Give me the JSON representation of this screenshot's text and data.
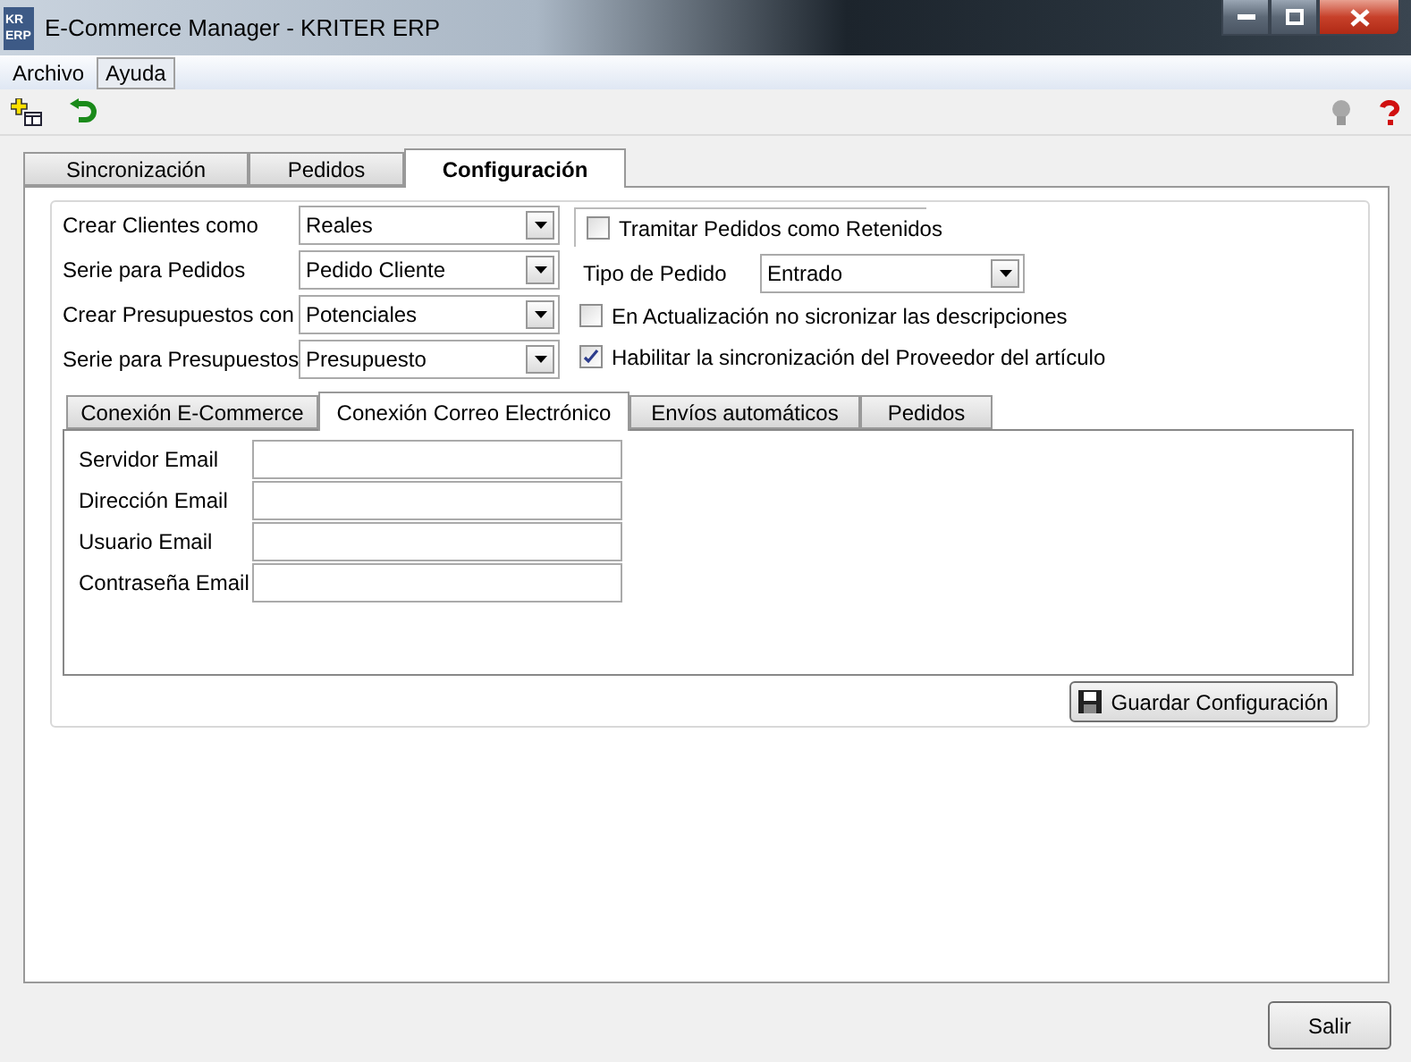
{
  "window": {
    "title": "E-Commerce Manager - KRITER ERP",
    "app_badge": [
      "KR",
      "ERP"
    ]
  },
  "menu": [
    {
      "label": "Archivo",
      "highlighted": false
    },
    {
      "label": "Ayuda",
      "highlighted": true
    }
  ],
  "tabs": [
    {
      "label": "Sincronización",
      "selected": false
    },
    {
      "label": "Pedidos",
      "selected": false
    },
    {
      "label": "Configuración",
      "selected": true
    }
  ],
  "settings": {
    "combos": [
      {
        "label": "Crear Clientes como",
        "value": "Reales"
      },
      {
        "label": "Serie para Pedidos",
        "value": "Pedido Cliente"
      },
      {
        "label": "Crear Presupuestos con",
        "value": "Potenciales"
      },
      {
        "label": "Serie para Presupuestos",
        "value": "Presupuesto"
      }
    ],
    "retained": {
      "label": "Tramitar Pedidos como Retenidos",
      "checked": false
    },
    "order_type": {
      "label": "Tipo de Pedido",
      "value": "Entrado"
    },
    "checks": [
      {
        "label": "En Actualización no sicronizar las descripciones",
        "checked": false
      },
      {
        "label": "Habilitar la sincronización del Proveedor del artículo",
        "checked": true
      }
    ]
  },
  "sub_tabs": [
    {
      "label": "Conexión E-Commerce",
      "selected": false
    },
    {
      "label": "Conexión Correo Electrónico",
      "selected": true
    },
    {
      "label": "Envíos automáticos",
      "selected": false
    },
    {
      "label": "Pedidos",
      "selected": false
    }
  ],
  "email_fields": [
    {
      "label": "Servidor Email"
    },
    {
      "label": "Dirección Email"
    },
    {
      "label": "Usuario Email"
    },
    {
      "label": "Contraseña Email"
    }
  ],
  "save_button": {
    "label": "Guardar Configuración"
  },
  "exit_button": {
    "label": "Salir"
  }
}
